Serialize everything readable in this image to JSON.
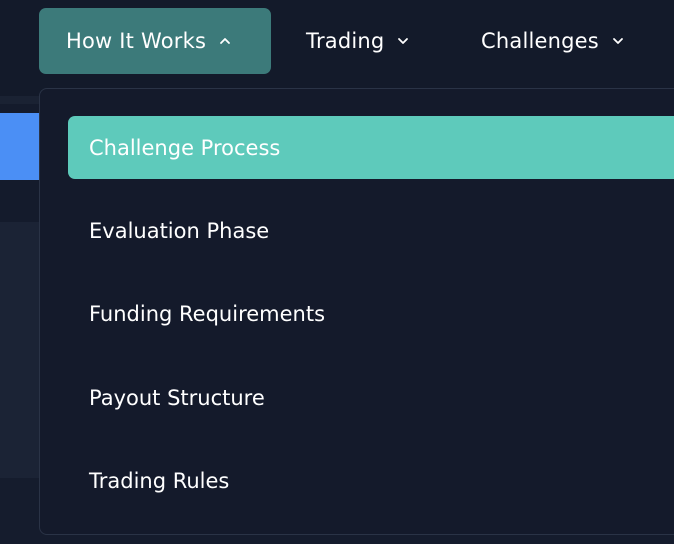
{
  "nav": {
    "items": [
      {
        "label": "How It Works",
        "expanded": true,
        "icon": "chevron-up-icon"
      },
      {
        "label": "Trading",
        "expanded": false,
        "icon": "chevron-down-icon"
      },
      {
        "label": "Challenges",
        "expanded": false,
        "icon": "chevron-down-icon"
      }
    ]
  },
  "dropdown": {
    "items": [
      {
        "label": "Challenge Process",
        "selected": true
      },
      {
        "label": "Evaluation Phase",
        "selected": false
      },
      {
        "label": "Funding Requirements",
        "selected": false
      },
      {
        "label": "Payout Structure",
        "selected": false
      },
      {
        "label": "Trading Rules",
        "selected": false
      }
    ]
  },
  "colors": {
    "background": "#141b2c",
    "active_nav": "#3c7a7a",
    "selected_item": "#5ecabb",
    "accent_button": "#4b8ff5"
  }
}
